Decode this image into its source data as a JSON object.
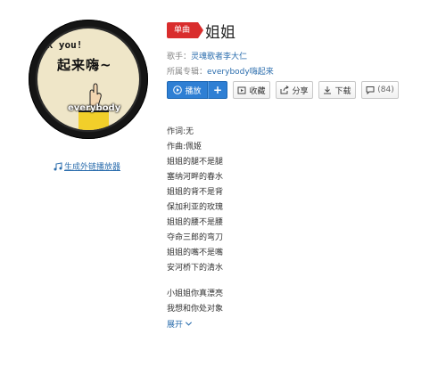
{
  "cover": {
    "top_text": "ck you!",
    "big_text": "起来嗨~",
    "word": "everybody"
  },
  "external_player_link": "生成外链播放器",
  "song": {
    "tag": "单曲",
    "title": "姐姐",
    "singer_label": "歌手：",
    "singer": "灵魂歌者李大仁",
    "album_label": "所属专辑：",
    "album": "everybody嗨起来"
  },
  "buttons": {
    "play": "播放",
    "add": "+",
    "favorite": "收藏",
    "share": "分享",
    "download": "下载",
    "comment_count": "(84)"
  },
  "lyrics": {
    "lines_a": [
      "作词:无",
      "作曲:佩姬",
      "姐姐的腿不是腿",
      "塞纳河畔的春水",
      "姐姐的背不是背",
      "保加利亚的玫瑰",
      "姐姐的腰不是腰",
      "夺命三郎的弯刀",
      "姐姐的嘴不是嘴",
      "安河桥下的清水"
    ],
    "lines_b": [
      "小姐姐你真漂亮",
      "我想和你处对象"
    ],
    "expand_label": "展开"
  },
  "colors": {
    "tag_red": "#d92d2d",
    "play_blue": "#2e7fd4",
    "link_blue": "#2b6dad"
  }
}
